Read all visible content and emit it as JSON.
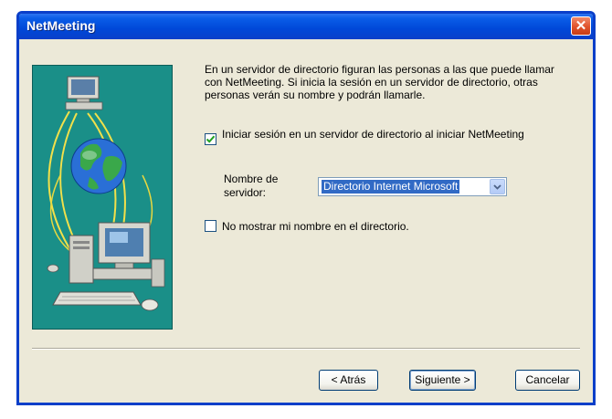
{
  "window": {
    "title": "NetMeeting",
    "close_glyph": "✕"
  },
  "content": {
    "intro": "En un servidor de directorio figuran las personas a las que puede llamar con NetMeeting. Si inicia la sesión en un servidor de directorio, otras personas verán su nombre y podrán llamarle.",
    "login_checkbox": {
      "label": "Iniciar sesión en un servidor de directorio al iniciar NetMeeting",
      "checked": true
    },
    "server": {
      "label_line1": "Nombre de",
      "label_line2": "servidor:",
      "selected": "Directorio Internet Microsoft"
    },
    "hide_name_checkbox": {
      "label": "No mostrar mi nombre en el directorio.",
      "checked": false
    }
  },
  "buttons": {
    "back": "< Atrás",
    "next": "Siguiente >",
    "cancel": "Cancelar"
  },
  "colors": {
    "titlebar": "#0a5de8",
    "illustration_bg": "#1a8f88",
    "selection": "#316ac5"
  },
  "icons": [
    "close-icon",
    "computer-icon",
    "globe-icon",
    "check-icon",
    "dropdown-arrow-icon"
  ]
}
